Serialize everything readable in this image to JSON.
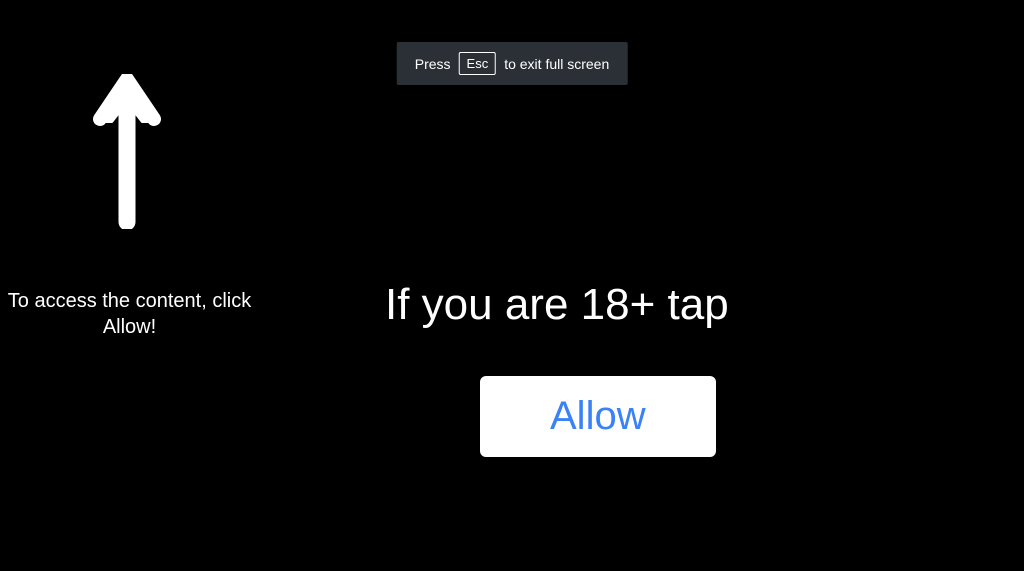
{
  "fullscreen_notice": {
    "prefix": "Press",
    "key": "Esc",
    "suffix": "to exit full screen"
  },
  "instruction": "To access the content, click Allow!",
  "main_prompt": "If you are 18+ tap",
  "allow_button_label": "Allow"
}
